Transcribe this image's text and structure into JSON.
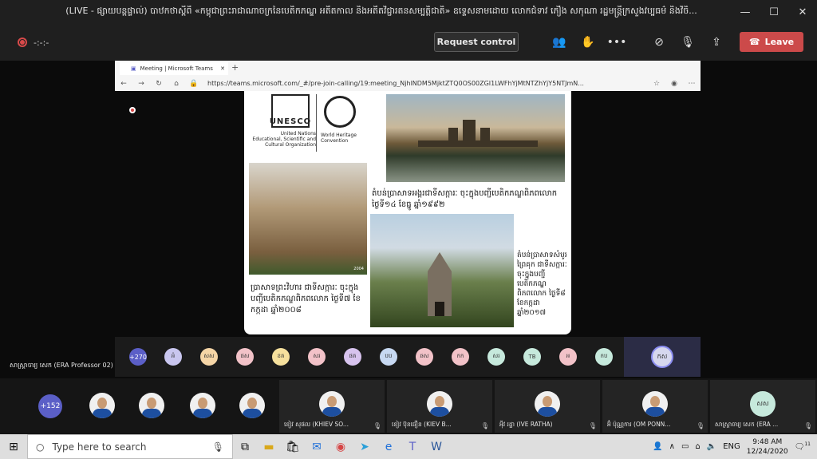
{
  "window": {
    "title": "(LIVE - ផ្សាយបន្តផ្ទាល់) បាឋកថាស្តីពី «កម្ពុជាព្រះរាជាណាចក្រនៃបេតិកភណ្ឌ អតីតកាល និងអតីតវិជ្ជារតនសម្បត្តិជាតិ» ឧទ្ទេសនាមដោយ លោកជំទាវ ភឿង សកុណា រដ្ឋមន្ត្រីក្រសួងវប្បធម៌ និងវិចិ...",
    "minimize": "—",
    "maximize": "☐",
    "close": "✕"
  },
  "meeting_toolbar": {
    "timer": "-:-:-",
    "request_control": "Request control",
    "leave": "Leave",
    "icons": [
      "participants-icon",
      "raise-hand-icon",
      "more-options-icon",
      "camera-off-icon",
      "mic-off-icon",
      "share-screen-icon"
    ]
  },
  "browser": {
    "tab_title": "Meeting | Microsoft Teams",
    "tab_close": "✕",
    "new_tab": "+",
    "url": "https://teams.microsoft.com/_#/pre-join-calling/19:meeting_NjhlNDM5MjktZTQ0OS00ZGI1LWFhYjMtNTZhYjY5NTJmN..."
  },
  "slide": {
    "unesco_name": "United Nations Educational, Scientific and Cultural Organization",
    "unesco_logo_text": "UNESCO",
    "whc_name": "World Heritage Convention",
    "caption_angkor": "តំបន់ប្រាសាទអង្គរជាទីសក្ការៈ ចុះក្នុងបញ្ជីបេតិកភណ្ឌពិភពលោក ថ្ងៃទី១៤ ខែធ្នូ ឆ្នាំ១៩៩២",
    "caption_preah_vihear": "ប្រាសាទព្រះវិហារ ជាទីសក្ការៈ ចុះក្នុងបញ្ជីបេតិកភណ្ឌពិភពលោក ថ្ងៃទី៧ ខែកក្កដា ឆ្នាំ២០០៨",
    "caption_sambor": "តំបន់ប្រាសាទសំបូរព្រៃគុក ជាទីសក្ការៈ ចុះក្នុងបញ្ជីបេតិកភណ្ឌពិភពលោក ថ្ងៃទី៨ ខែកក្កដា ឆ្នាំ២០១៧",
    "img_tag": "2004"
  },
  "participants_strip": {
    "count": "+270",
    "bubbles": [
      {
        "initials": "អំ",
        "color": "#c9c6ef"
      },
      {
        "initials": "សស",
        "color": "#f5d5a6"
      },
      {
        "initials": "ផស",
        "color": "#f2c2c8"
      },
      {
        "initials": "ខគ",
        "color": "#f6e09d"
      },
      {
        "initials": "សរ",
        "color": "#f2c2c8"
      },
      {
        "initials": "ផគ",
        "color": "#d7c3ee"
      },
      {
        "initials": "បប",
        "color": "#c7d9f2"
      },
      {
        "initials": "ឆស",
        "color": "#f2c2c8"
      },
      {
        "initials": "កក",
        "color": "#f2c2c8"
      },
      {
        "initials": "សរ",
        "color": "#c6e9dc"
      },
      {
        "initials": "TB",
        "color": "#c6e9dc"
      },
      {
        "initials": "អ",
        "color": "#f2c2c8"
      },
      {
        "initials": "កប",
        "color": "#c6e9dc"
      }
    ],
    "self_initials": "កស"
  },
  "speaker_label": "សាស្ត្រាចារ្យ សេក (ERA Professor 02)",
  "gallery": {
    "count": "+152",
    "tiles": [
      {
        "name": "ខៀវ សុផល (KHIEV SO..."
      },
      {
        "name": "ខៀវ ប៊ុនធឿន (KIEV B..."
      },
      {
        "name": "អុីវ រដ្ឋា (IVE RATHA)"
      },
      {
        "name": "អ៊ំ ប៉ុណ្ណការ (OM PONN..."
      },
      {
        "name": "សាស្ត្រាចារ្យ សេក (ERA ..."
      }
    ],
    "last_initials": "សស"
  },
  "taskbar": {
    "search_placeholder": "Type here to search",
    "time": "9:48 AM",
    "date": "12/24/2020",
    "lang": "ENG",
    "notifications": "11"
  }
}
